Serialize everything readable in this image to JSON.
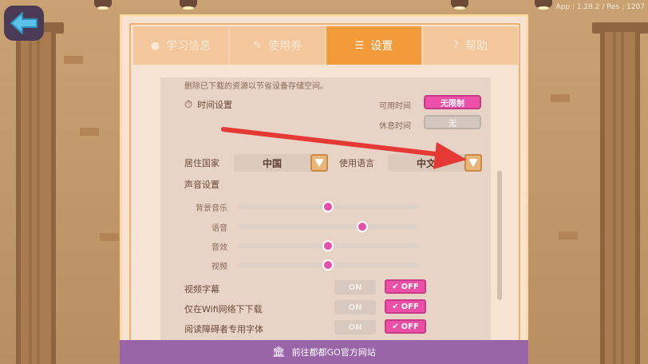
{
  "app": {
    "version_text": "App : 1.28.2 / Res : 1207"
  },
  "tabs": [
    {
      "label": "学习信息",
      "icon": "person-icon",
      "active": false
    },
    {
      "label": "使用券",
      "icon": "pencil-icon",
      "active": false
    },
    {
      "label": "设置",
      "icon": "sliders-icon",
      "active": true
    },
    {
      "label": "帮助",
      "icon": "help-icon",
      "active": false
    }
  ],
  "settings": {
    "storage_hint": "删除已下载的资源以节省设备存储空间。",
    "time_section_label": "时间设置",
    "available_time_label": "可用时间",
    "available_time_value": "无限制",
    "rest_time_label": "休息时间",
    "rest_time_value": "无",
    "country_label": "居住国家",
    "country_value": "中国",
    "language_label": "使用语言",
    "language_value": "中文",
    "sound_section_label": "声音设置",
    "sliders": [
      {
        "label": "背景音乐",
        "value": 0.5
      },
      {
        "label": "语音",
        "value": 0.69
      },
      {
        "label": "音效",
        "value": 0.5
      },
      {
        "label": "视频",
        "value": 0.5
      }
    ],
    "toggles": [
      {
        "label": "视频字幕",
        "on_label": "ON",
        "off_label": "OFF"
      },
      {
        "label": "仅在Wifi网络下下载",
        "on_label": "ON",
        "off_label": "OFF"
      },
      {
        "label": "阅读障碍者专用字体",
        "on_label": "ON",
        "off_label": "OFF"
      }
    ]
  },
  "footer": {
    "label": "前往都都GO官方网站",
    "icon": "building-icon"
  },
  "colors": {
    "accent_pink": "#ec4fa6",
    "tab_active": "#f39a3a",
    "footer": "#9a64a9",
    "arrow": "#e53935"
  }
}
